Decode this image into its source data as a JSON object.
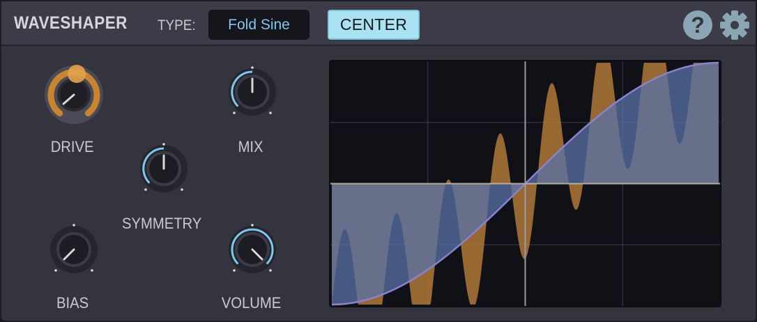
{
  "header": {
    "title": "WAVESHAPER",
    "type_label": "TYPE:",
    "type_value": "Fold Sine",
    "center_button": "CENTER",
    "help_icon": "question-circle-icon",
    "settings_icon": "gear-icon"
  },
  "knobs": {
    "drive": {
      "label": "DRIVE",
      "value": 0.0,
      "style": "active-orange"
    },
    "mix": {
      "label": "MIX",
      "value": 0.5
    },
    "symmetry": {
      "label": "SYMMETRY",
      "value": 0.5
    },
    "bias": {
      "label": "BIAS",
      "value": 0.0
    },
    "volume": {
      "label": "VOLUME",
      "value": 0.8
    }
  },
  "graph": {
    "shape": "fold-sine",
    "transfer_curve": "sine-s-curve",
    "folds": 7.5,
    "fold_amplitude": 0.62,
    "colors": {
      "background": "#0f1117",
      "grid": "#3a3d49",
      "center_line": "#9a9aa2",
      "folded_wave": "#b07838",
      "transfer_curve": "#5872a8",
      "transfer_line": "#8a82d0"
    }
  },
  "colors": {
    "accent_blue": "#7cc8ee",
    "accent_orange": "#d99a3a",
    "panel": "#33343e",
    "header": "#3b3c47"
  }
}
